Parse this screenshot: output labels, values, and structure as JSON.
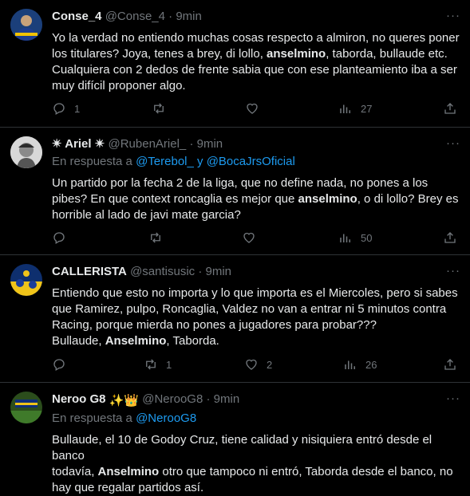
{
  "tweets": [
    {
      "name": "Conse_4",
      "handle": "@Conse_4",
      "time": "9min",
      "text_lines": [
        [
          {
            "t": "Yo la verdad no entiendo muchas cosas respecto a almiron, no queres poner"
          }
        ],
        [
          {
            "t": "los titulares? Joya, tenes a brey, di lollo, "
          },
          {
            "t": "anselmino",
            "b": true
          },
          {
            "t": ", taborda, bullaude etc."
          }
        ],
        [
          {
            "t": "Cualquiera con 2 dedos de frente sabia que con ese planteamiento iba a ser"
          }
        ],
        [
          {
            "t": "muy difícil proponer algo."
          }
        ]
      ],
      "replies": "1",
      "retweets": "",
      "likes": "",
      "views": "27"
    },
    {
      "name_prefix": "✴",
      "name": "Ariel",
      "name_suffix": "✴",
      "handle": "@RubenAriel_",
      "time": "9min",
      "reply_label": "En respuesta a",
      "reply_targets": [
        "@Terebol_",
        "y",
        "@BocaJrsOficial"
      ],
      "text_lines": [
        [
          {
            "t": "Un partido por la fecha 2 de la liga, que no define nada, no pones a los"
          }
        ],
        [
          {
            "t": "pibes? En que context roncaglia es mejor que "
          },
          {
            "t": "anselmino",
            "b": true
          },
          {
            "t": ", o di lollo? Brey es"
          }
        ],
        [
          {
            "t": "horrible al lado de javi mate garcia?"
          }
        ]
      ],
      "replies": "",
      "retweets": "",
      "likes": "",
      "views": "50"
    },
    {
      "name": "CALLERISTA",
      "handle": "@santisusic",
      "time": "9min",
      "text_lines": [
        [
          {
            "t": "Entiendo que esto no importa y lo que importa es el Miercoles, pero si sabes"
          }
        ],
        [
          {
            "t": "que Ramirez, pulpo, Roncaglia, Valdez no van a entrar ni 5 minutos contra"
          }
        ],
        [
          {
            "t": "Racing, porque mierda no pones a jugadores para probar???"
          }
        ],
        [
          {
            "t": "Bullaude, "
          },
          {
            "t": "Anselmino",
            "b": true
          },
          {
            "t": ", Taborda."
          }
        ]
      ],
      "replies": "",
      "retweets": "1",
      "likes": "2",
      "views": "26"
    },
    {
      "name": "Neroo G8",
      "name_badges": "✨👑",
      "handle": "@NerooG8",
      "time": "9min",
      "reply_label": "En respuesta a",
      "reply_targets": [
        "@NerooG8"
      ],
      "text_lines": [
        [
          {
            "t": "Bullaude, el 10 de Godoy Cruz, tiene calidad y nisiquiera entró desde el banco"
          }
        ],
        [
          {
            "t": "todavía, "
          },
          {
            "t": "Anselmino",
            "b": true
          },
          {
            "t": " otro que tampoco ni entró, Taborda desde el banco, no"
          }
        ],
        [
          {
            "t": "hay que regalar partidos así."
          }
        ]
      ]
    }
  ],
  "colors": {
    "muted": "#71767b",
    "link": "#1d9bf0",
    "text": "#e7e9ea",
    "divider": "#2f3336"
  }
}
